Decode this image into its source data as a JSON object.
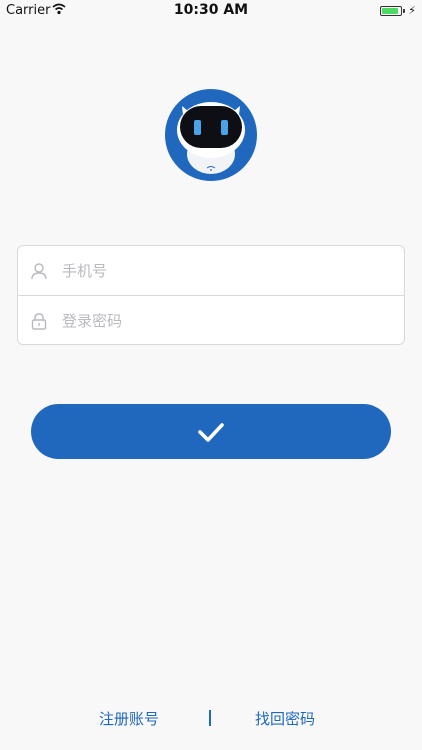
{
  "status_bar": {
    "carrier": "Carrier",
    "time": "10:30 AM",
    "battery_color": "#4cd964"
  },
  "login_form": {
    "phone_placeholder": "手机号",
    "password_placeholder": "登录密码"
  },
  "submit": {
    "icon": "checkmark-icon"
  },
  "links": {
    "register": "注册账号",
    "forgot_password": "找回密码"
  },
  "colors": {
    "brand": "#2068bd",
    "background": "#f8f8f9",
    "border": "#d9d9df",
    "placeholder": "#b9b9bf"
  }
}
